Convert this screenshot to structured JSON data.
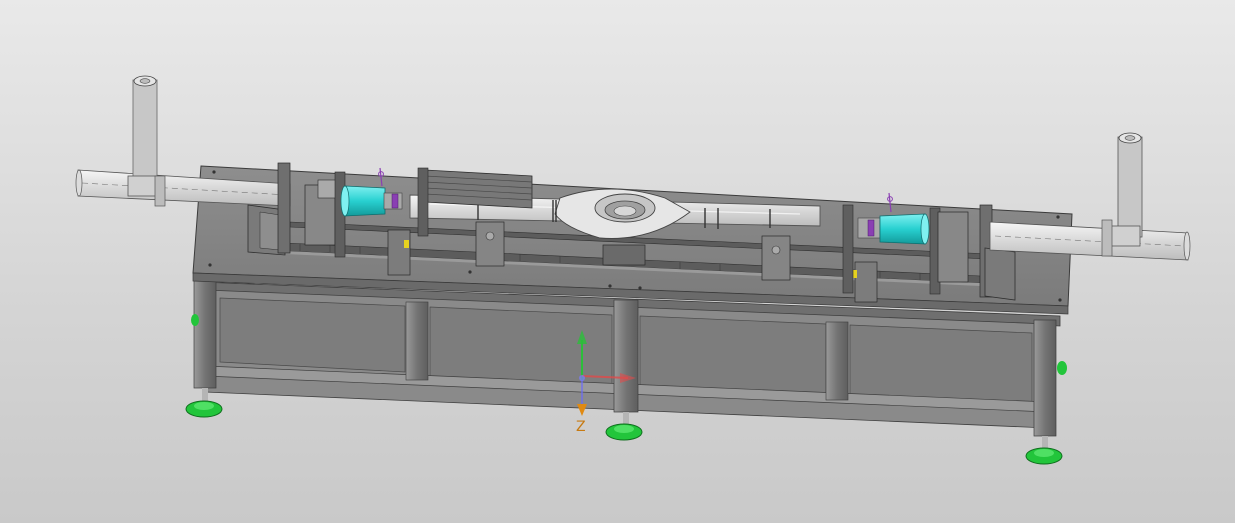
{
  "viewport": {
    "background": [
      "#e9e9e9",
      "#c9c9c9"
    ]
  },
  "model": {
    "frame_color": "#7a7a7a",
    "frame_dark": "#5d5d5d",
    "panel_color": "#8c8c8c",
    "shaft_color": "#e4e4e4",
    "hub_color": "#33d6d6",
    "foot_color": "#22c53b",
    "accent_purple": "#8a3fb3"
  },
  "triad": {
    "z_label": "Z",
    "x_color": "#e04b4b",
    "y_color": "#2bbf3a",
    "z_color": "#e08a12",
    "label_color": "#c77a12"
  }
}
